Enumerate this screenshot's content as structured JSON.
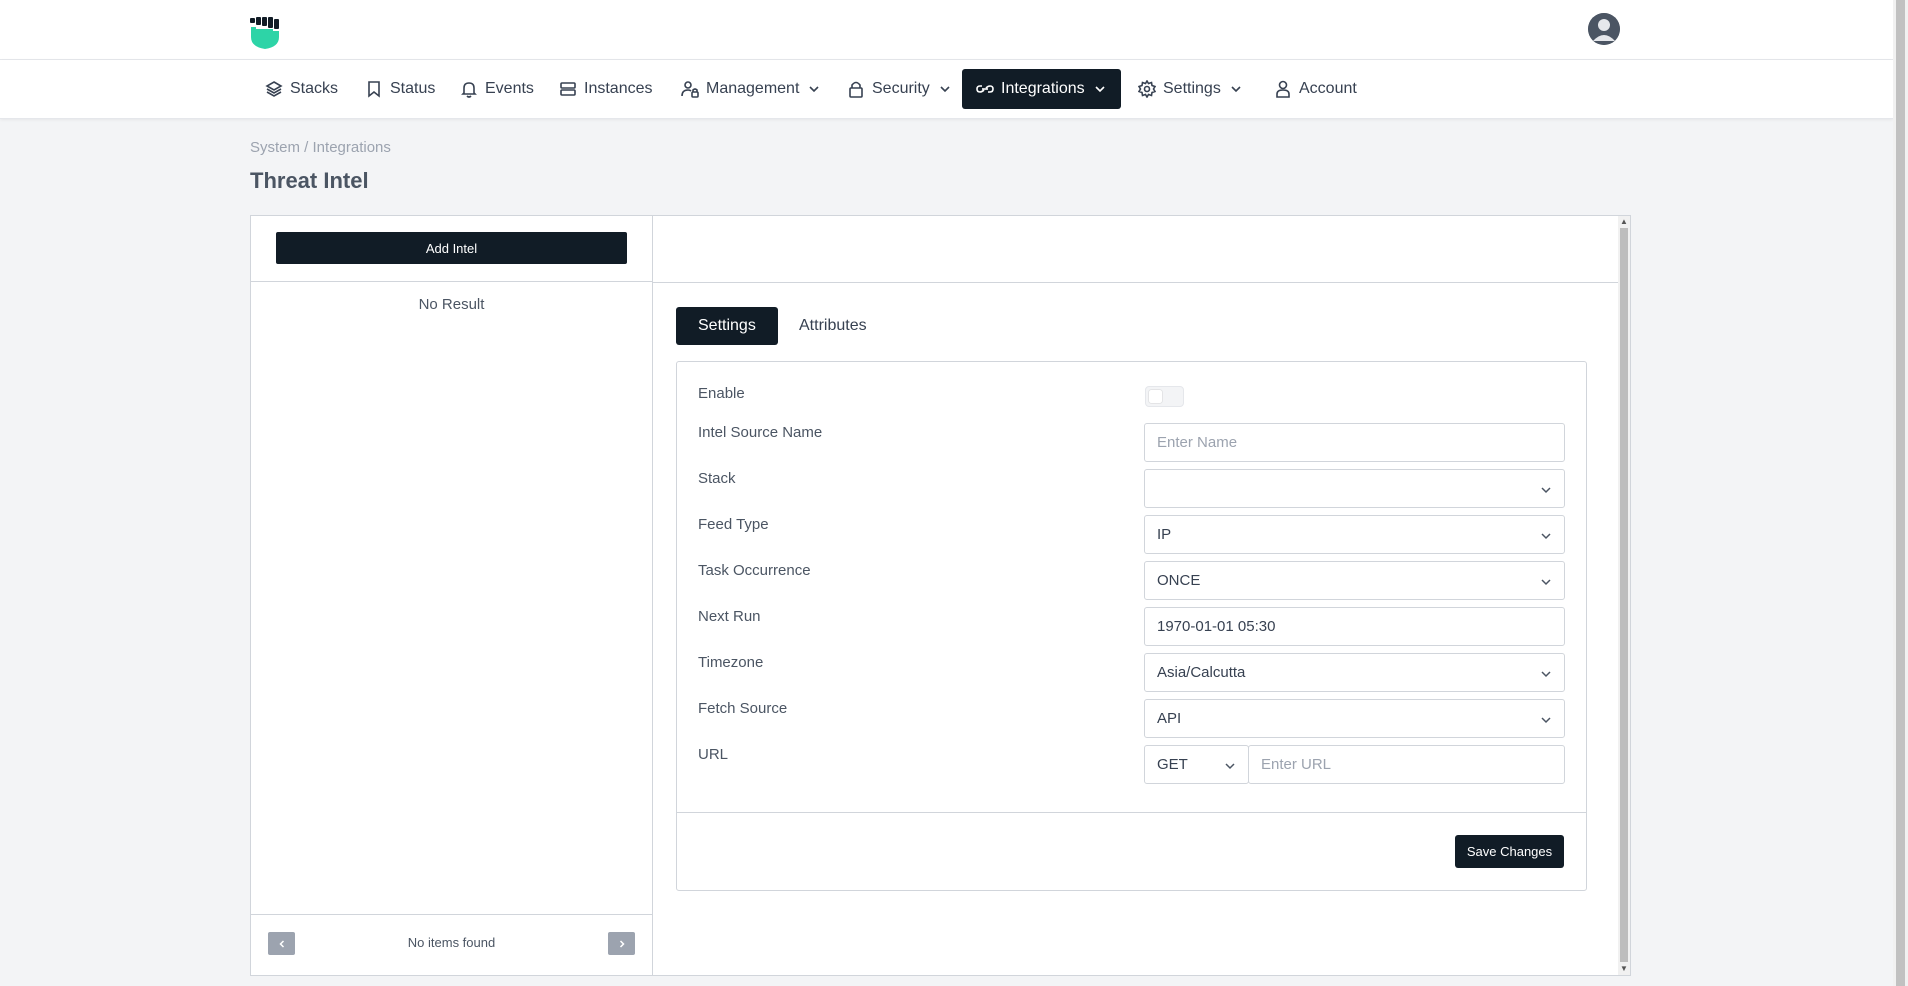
{
  "header": {
    "logo_icon": "shield-fist-icon",
    "avatar_icon": "user-avatar-icon"
  },
  "nav": {
    "items": [
      {
        "label": "Stacks",
        "icon": "layers-icon",
        "has_dropdown": false
      },
      {
        "label": "Status",
        "icon": "bookmark-icon",
        "has_dropdown": false
      },
      {
        "label": "Events",
        "icon": "bell-icon",
        "has_dropdown": false
      },
      {
        "label": "Instances",
        "icon": "server-icon",
        "has_dropdown": false
      },
      {
        "label": "Management",
        "icon": "user-lock-icon",
        "has_dropdown": true
      },
      {
        "label": "Security",
        "icon": "lock-icon",
        "has_dropdown": true
      },
      {
        "label": "Integrations",
        "icon": "link-icon",
        "has_dropdown": true,
        "active": true
      },
      {
        "label": "Settings",
        "icon": "gear-icon",
        "has_dropdown": true
      },
      {
        "label": "Account",
        "icon": "user-icon",
        "has_dropdown": false
      }
    ]
  },
  "breadcrumb": "System / Integrations",
  "page_title": "Threat Intel",
  "left_panel": {
    "add_button": "Add Intel",
    "empty_text": "No Result",
    "footer_text": "No items found",
    "prev_icon": "chevron-left-icon",
    "next_icon": "chevron-right-icon"
  },
  "tabs": [
    {
      "label": "Settings",
      "active": true
    },
    {
      "label": "Attributes",
      "active": false
    }
  ],
  "form": {
    "enable": {
      "label": "Enable",
      "value": false
    },
    "intel_source_name": {
      "label": "Intel Source Name",
      "value": "",
      "placeholder": "Enter Name"
    },
    "stack": {
      "label": "Stack",
      "value": ""
    },
    "feed_type": {
      "label": "Feed Type",
      "value": "IP"
    },
    "task_occurrence": {
      "label": "Task Occurrence",
      "value": "ONCE"
    },
    "next_run": {
      "label": "Next Run",
      "value": "1970-01-01 05:30"
    },
    "timezone": {
      "label": "Timezone",
      "value": "Asia/Calcutta"
    },
    "fetch_source": {
      "label": "Fetch Source",
      "value": "API"
    },
    "url": {
      "label": "URL",
      "method": "GET",
      "value": "",
      "placeholder": "Enter URL"
    },
    "save_button": "Save Changes"
  },
  "colors": {
    "primary_dark": "#111c26",
    "brand_teal": "#2dd4a7",
    "page_bg": "#f3f4f6"
  }
}
